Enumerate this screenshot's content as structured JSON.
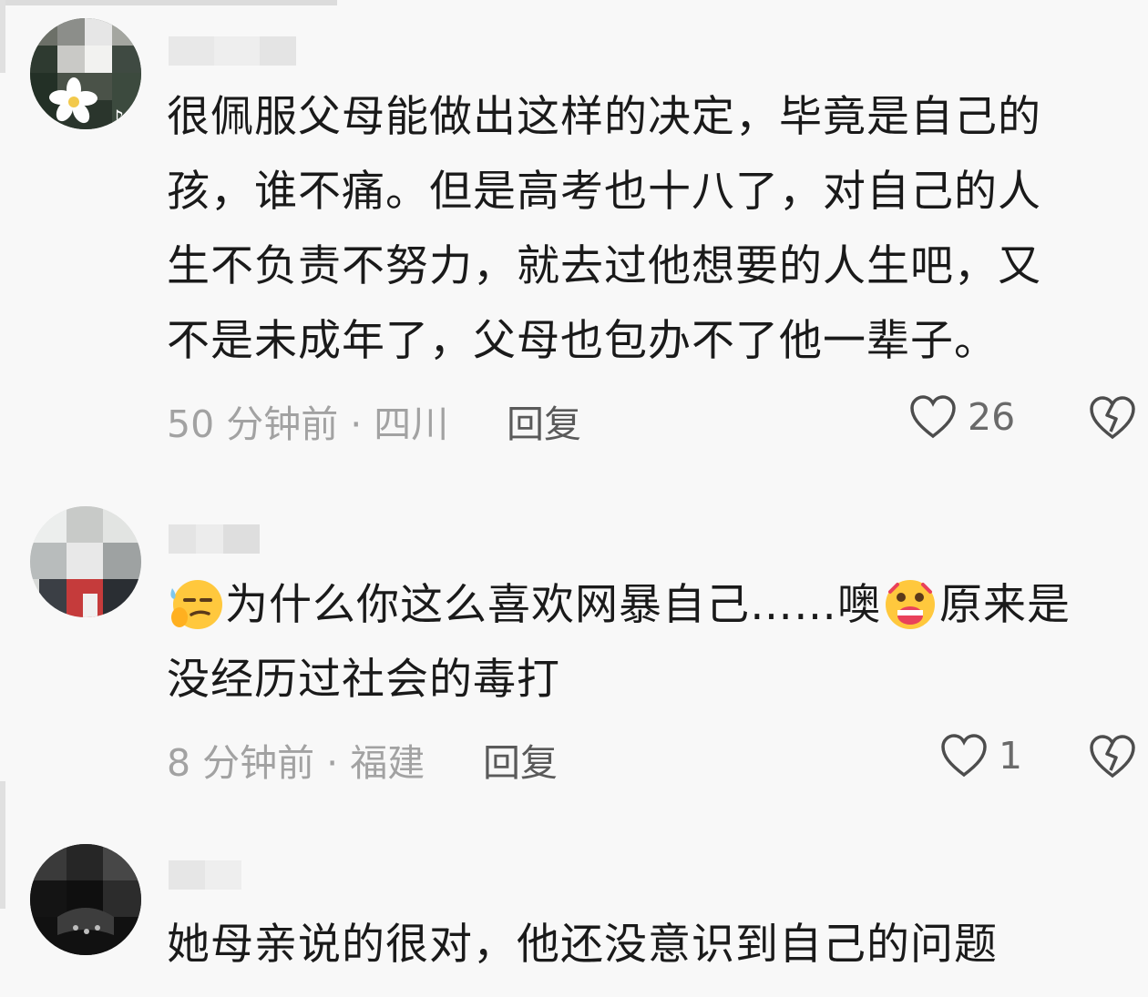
{
  "comments": [
    {
      "text_lines": [
        "很佩服父母能做出这样的决定，毕竟是自己的",
        "孩，谁不痛。但是高考也十八了，对自己的人",
        "生不负责不努力，就去过他想要的人生吧，又",
        "不是未成年了，父母也包办不了他一辈子。"
      ],
      "time": "50 分钟前 · 四川",
      "reply_label": "回复",
      "likes": "26"
    },
    {
      "text_line1_a": "为什么你这么喜欢网暴自己……噢",
      "text_line1_b": "原来是",
      "text_line2": "没经历过社会的毒打",
      "time": "8 分钟前 · 福建",
      "reply_label": "回复",
      "likes": "1"
    },
    {
      "text_line1": "她母亲说的很对，他还没意识到自己的问题"
    }
  ],
  "icons": {
    "like": "heart-outline-icon",
    "dislike": "broken-heart-icon",
    "emoji1": "smirk-emoji",
    "emoji2": "surprised-emoji"
  },
  "colors": {
    "text": "#1a1a1a",
    "meta": "#a2a2a2",
    "background": "#f8f8f8"
  }
}
